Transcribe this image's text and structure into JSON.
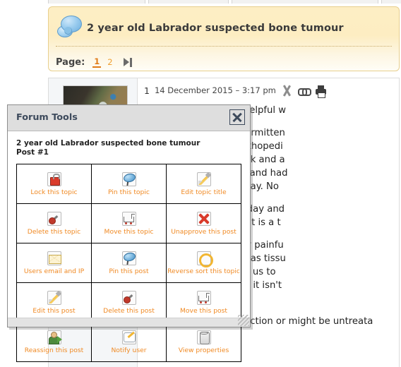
{
  "nav": {
    "tabs": [
      "",
      "",
      "",
      ""
    ]
  },
  "topic": {
    "icon": "speech-bubble-icon",
    "title": "2 year old Labrador suspected bone tumour",
    "page_label": "Page:",
    "pages": [
      "1",
      "2"
    ],
    "active_page": "1",
    "next_page_icon": "last-page-icon"
  },
  "post": {
    "number": "1",
    "date": "14 December 2015 – 3:17 pm",
    "meta_icons": [
      "tools-icon",
      "link-icon",
      "print-icon"
    ],
    "avatar": "user-avatar",
    "paragraphs": [
      "and found this really helpful w",
      "brador has had an intermitten\nbeen referred to an orthopedi\nHad first appt last week and a\noma). So he stayed in and had\njust blood test and X Ray. No",
      "touch with the vets today and\ne still unsure whether it is a t",
      "psy which is extremely painfu\net definitive diagnosis as tissu\nfor results which takes us to\nWhich seems drastic if it isn't\nwasn't this.",
      "Although if it is an infection or might be untreata"
    ]
  },
  "dialog": {
    "title": "Forum Tools",
    "close_icon": "close-icon",
    "subject": "2 year old Labrador suspected bone tumour",
    "post_number": "Post #1",
    "resize_icon": "resize-grip-icon",
    "tools": [
      {
        "icon": "lock-icon",
        "label": "Lock this topic"
      },
      {
        "icon": "pin-icon",
        "label": "Pin this topic"
      },
      {
        "icon": "pencil-icon",
        "label": "Edit topic title"
      },
      {
        "icon": "wrench-icon",
        "label": "Delete this topic"
      },
      {
        "icon": "cart-icon",
        "label": "Move this topic"
      },
      {
        "icon": "x-icon",
        "label": "Unapprove this post"
      },
      {
        "icon": "mail-icon",
        "label": "Users email and IP"
      },
      {
        "icon": "pin-icon",
        "label": "Pin this post"
      },
      {
        "icon": "refresh-icon",
        "label": "Reverse sort this topic"
      },
      {
        "icon": "pencil-icon",
        "label": "Edit this post"
      },
      {
        "icon": "wrench-icon",
        "label": "Delete this post"
      },
      {
        "icon": "cart-icon",
        "label": "Move this post"
      },
      {
        "icon": "user-icon",
        "label": "Reassign this post"
      },
      {
        "icon": "notify-icon",
        "label": "Notify user"
      },
      {
        "icon": "props-icon",
        "label": "View properties"
      }
    ]
  },
  "colors": {
    "topic_bg": "#fdeec4",
    "topic_border": "#e8cf8e",
    "accent_orange": "#f08a24",
    "active_page": "#e07b18",
    "dialog_titlebar": "#dedede",
    "dialog_title_text": "#3d4a5c"
  }
}
